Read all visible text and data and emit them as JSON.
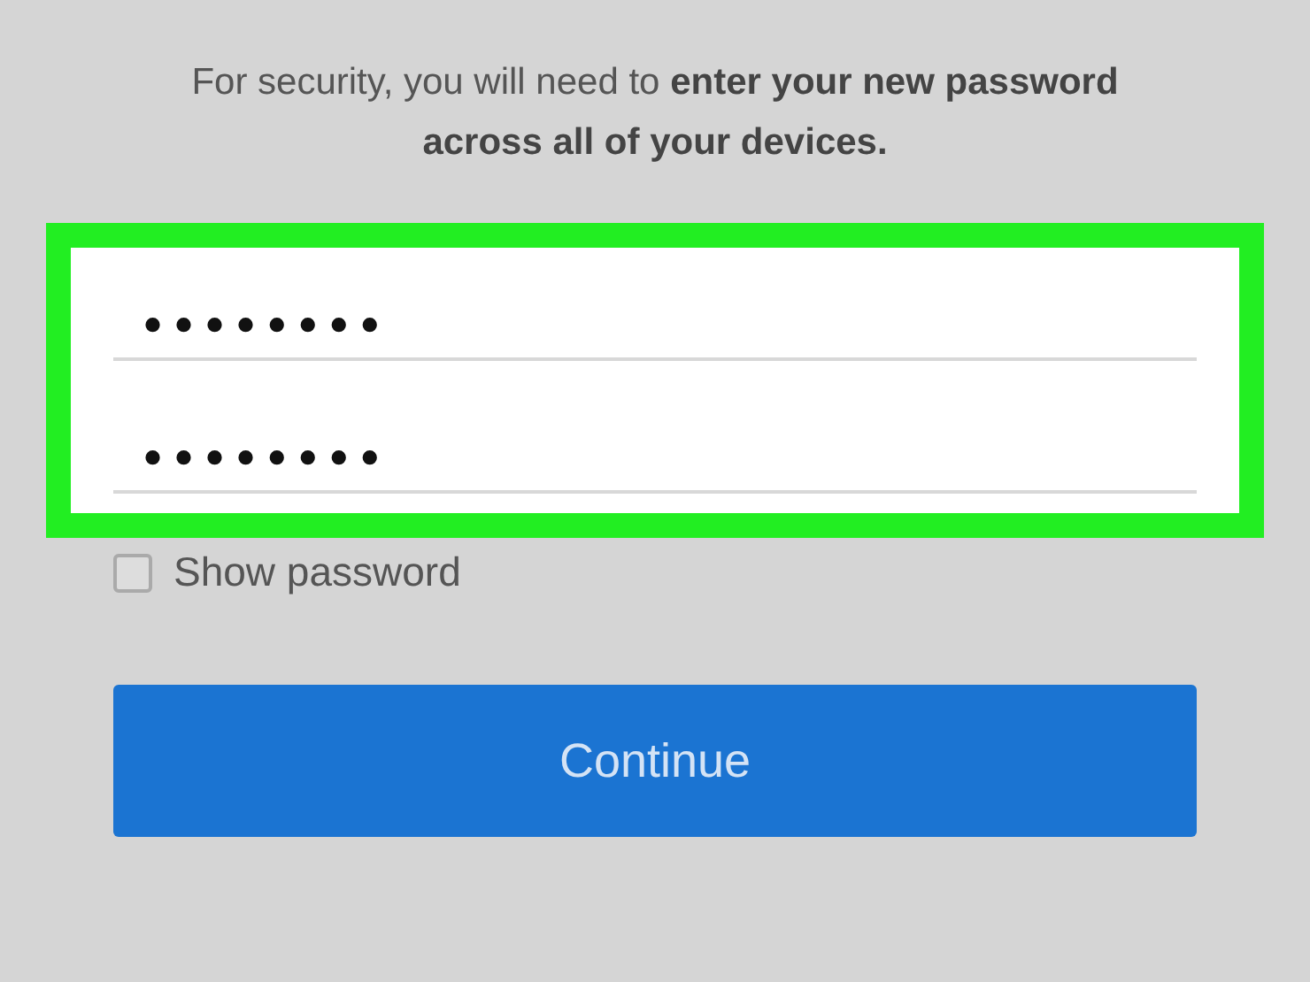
{
  "message": "For security, you will need to **enter your new password across all of your devices.**",
  "password_group": {
    "highlighted": true,
    "fields": [
      {
        "value": "••••••••"
      },
      {
        "value": "••••••••"
      }
    ]
  },
  "show_password": {
    "label": "Show password",
    "checked": false
  },
  "button": {
    "label": "Continue"
  }
}
